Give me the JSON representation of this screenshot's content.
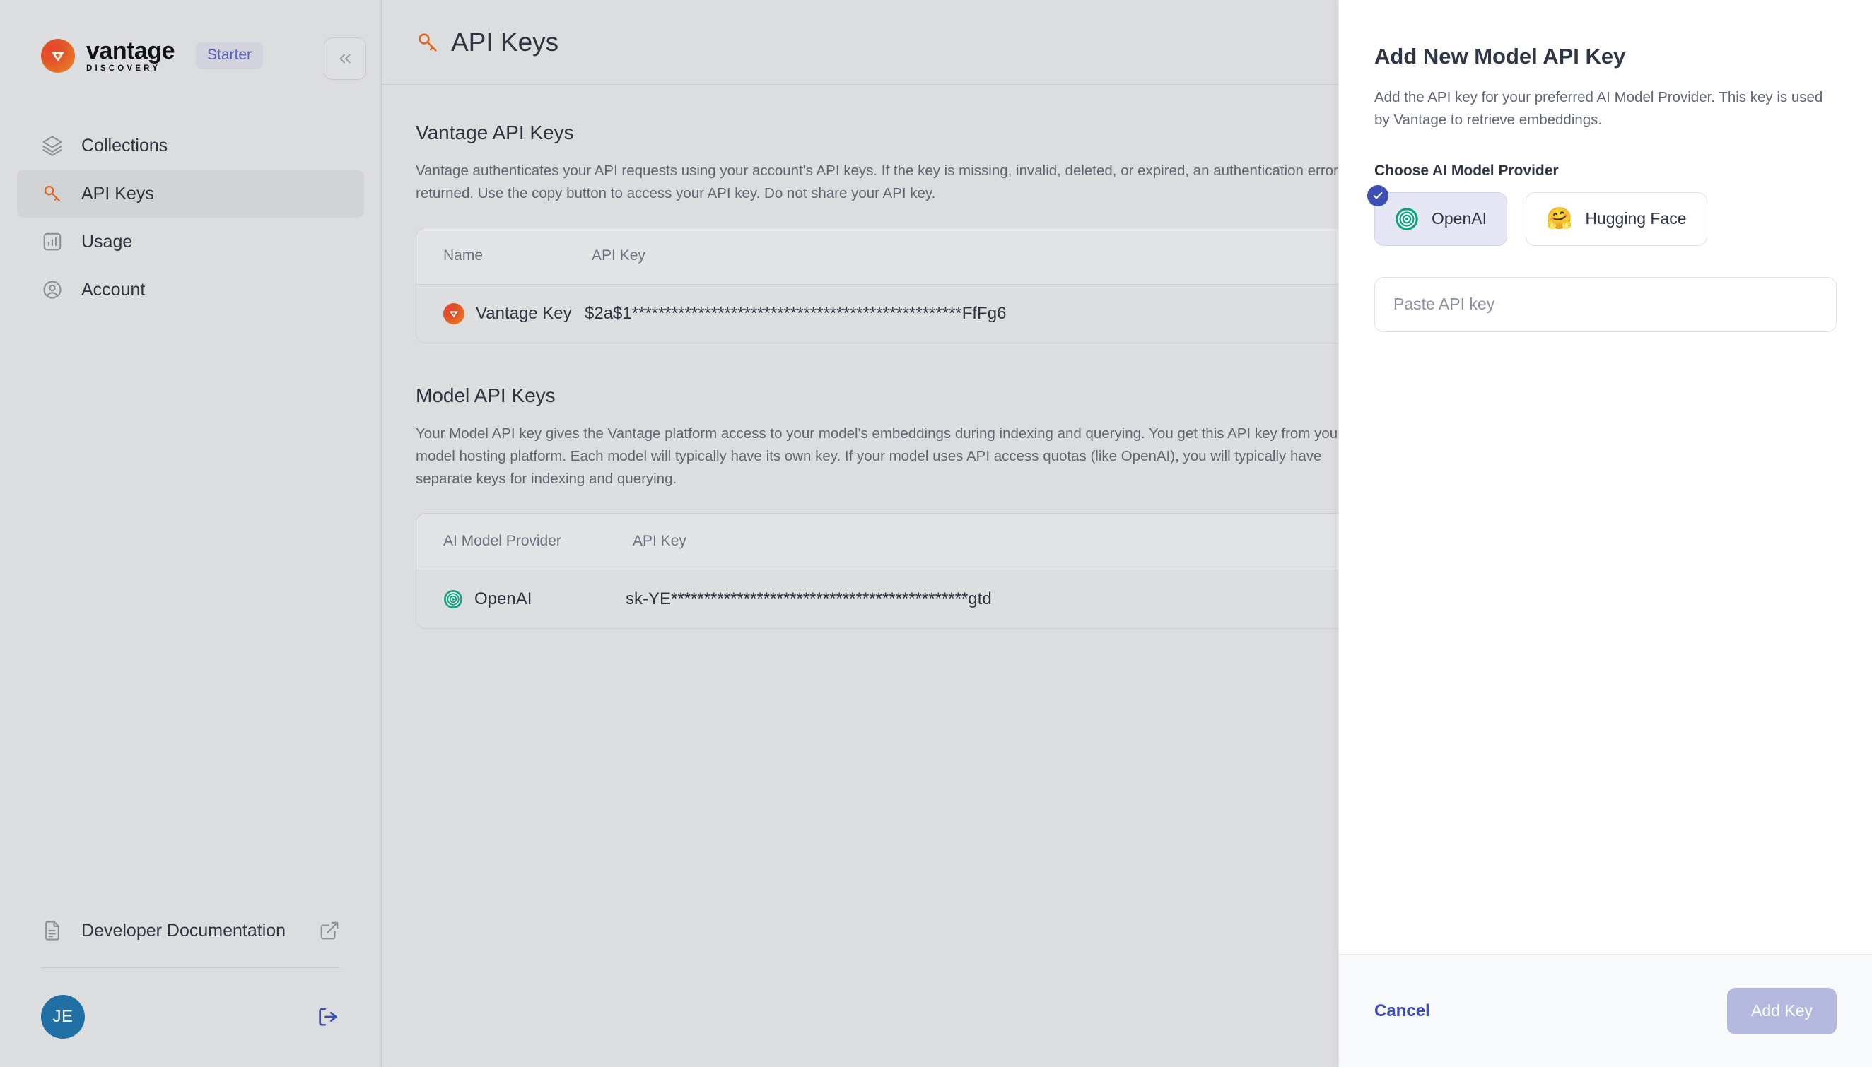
{
  "sidebar": {
    "brand": {
      "word": "vantage",
      "sub": "DISCOVERY",
      "plan_badge": "Starter",
      "logo_icon": "vantage-logo-icon"
    },
    "collapse_icon": "chevron-double-left-icon",
    "items": [
      {
        "label": "Collections",
        "icon": "layers-icon",
        "active": false
      },
      {
        "label": "API Keys",
        "icon": "key-icon",
        "active": true
      },
      {
        "label": "Usage",
        "icon": "bar-chart-icon",
        "active": false
      },
      {
        "label": "Account",
        "icon": "user-circle-icon",
        "active": false
      }
    ],
    "doc_link": {
      "label": "Developer Documentation",
      "icon": "document-icon",
      "external_icon": "external-link-icon"
    },
    "user": {
      "initials": "JE",
      "logout_icon": "logout-icon"
    }
  },
  "main": {
    "page_title": "API Keys",
    "page_title_icon": "key-icon",
    "vantage_section": {
      "title": "Vantage API Keys",
      "description": "Vantage authenticates your API requests using your account's API keys. If the key is missing, invalid, deleted, or expired, an authentication error is returned. Use the copy button to access your API key. Do not share your API key.",
      "columns": [
        "Name",
        "API Key"
      ],
      "rows": [
        {
          "name": "Vantage Key",
          "icon": "vantage-logo-icon",
          "key": "$2a$1**************************************************FfFg6"
        }
      ]
    },
    "model_section": {
      "title": "Model API Keys",
      "description": "Your Model API key gives the Vantage platform access to your model's embeddings during indexing and querying. You get this API key from your model hosting platform. Each model will typically have its own key. If your model uses API access quotas (like OpenAI), you will typically have separate keys for indexing and querying.",
      "columns": [
        "AI Model Provider",
        "API Key"
      ],
      "rows": [
        {
          "name": "OpenAI",
          "icon": "openai-icon",
          "key": "sk-YE*********************************************gtd"
        }
      ]
    }
  },
  "panel": {
    "title": "Add New Model API Key",
    "description": "Add the API key for your preferred AI Model Provider. This key is used by Vantage to retrieve embeddings.",
    "provider_label": "Choose AI Model Provider",
    "providers": [
      {
        "name": "OpenAI",
        "icon": "openai-icon",
        "selected": true,
        "check_icon": "check-icon"
      },
      {
        "name": "Hugging Face",
        "icon": "hugging-face-icon",
        "selected": false
      }
    ],
    "api_key_input": {
      "value": "",
      "placeholder": "Paste API key"
    },
    "footer": {
      "cancel_label": "Cancel",
      "submit_label": "Add Key",
      "submit_disabled": true
    }
  },
  "colors": {
    "accent_orange": "#e0542a",
    "accent_indigo": "#3d4fb5",
    "openai_green": "#10a37f",
    "avatar_blue": "#2170a5",
    "sidebar_bg": "#dcdddf",
    "panel_bg": "#ffffff"
  }
}
